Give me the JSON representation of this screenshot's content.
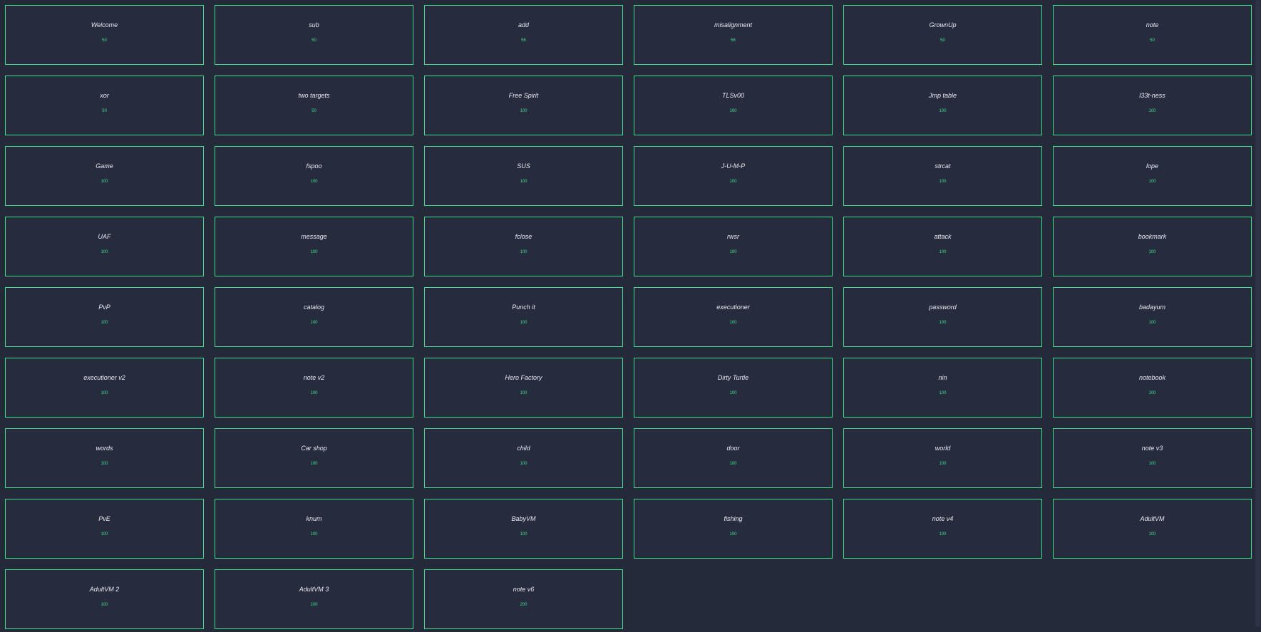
{
  "accent": "#3fe08a",
  "background": "#252a3b",
  "challenges": [
    {
      "name": "Welcome",
      "points": "50"
    },
    {
      "name": "sub",
      "points": "50"
    },
    {
      "name": "add",
      "points": "56"
    },
    {
      "name": "misalignment",
      "points": "56"
    },
    {
      "name": "GrownUp",
      "points": "50"
    },
    {
      "name": "note",
      "points": "50"
    },
    {
      "name": "xor",
      "points": "50"
    },
    {
      "name": "two targets",
      "points": "50"
    },
    {
      "name": "Free Spirit",
      "points": "100"
    },
    {
      "name": "TLSv00",
      "points": "100"
    },
    {
      "name": "Jmp table",
      "points": "100"
    },
    {
      "name": "l33t-ness",
      "points": "100"
    },
    {
      "name": "Game",
      "points": "100"
    },
    {
      "name": "fspoo",
      "points": "100"
    },
    {
      "name": "SUS",
      "points": "100"
    },
    {
      "name": "J-U-M-P",
      "points": "100"
    },
    {
      "name": "strcat",
      "points": "100"
    },
    {
      "name": "lope",
      "points": "100"
    },
    {
      "name": "UAF",
      "points": "100"
    },
    {
      "name": "message",
      "points": "100"
    },
    {
      "name": "fclose",
      "points": "100"
    },
    {
      "name": "rwsr",
      "points": "100"
    },
    {
      "name": "attack",
      "points": "100"
    },
    {
      "name": "bookmark",
      "points": "100"
    },
    {
      "name": "PvP",
      "points": "100"
    },
    {
      "name": "catalog",
      "points": "100"
    },
    {
      "name": "Punch it",
      "points": "100"
    },
    {
      "name": "executioner",
      "points": "100"
    },
    {
      "name": "password",
      "points": "100"
    },
    {
      "name": "badayum",
      "points": "100"
    },
    {
      "name": "executioner v2",
      "points": "100"
    },
    {
      "name": "note v2",
      "points": "100"
    },
    {
      "name": "Hero Factory",
      "points": "100"
    },
    {
      "name": "Dirty Turtle",
      "points": "100"
    },
    {
      "name": "nin",
      "points": "100"
    },
    {
      "name": "notebook",
      "points": "100"
    },
    {
      "name": "words",
      "points": "100"
    },
    {
      "name": "Car shop",
      "points": "100"
    },
    {
      "name": "child",
      "points": "100"
    },
    {
      "name": "door",
      "points": "100"
    },
    {
      "name": "world",
      "points": "100"
    },
    {
      "name": "note v3",
      "points": "100"
    },
    {
      "name": "PvE",
      "points": "100"
    },
    {
      "name": "knum",
      "points": "100"
    },
    {
      "name": "BabyVM",
      "points": "100"
    },
    {
      "name": "fishing",
      "points": "100"
    },
    {
      "name": "note v4",
      "points": "100"
    },
    {
      "name": "AdultVM",
      "points": "100"
    },
    {
      "name": "AdultVM 2",
      "points": "100"
    },
    {
      "name": "AdultVM 3",
      "points": "100"
    },
    {
      "name": "note v6",
      "points": "200"
    }
  ]
}
